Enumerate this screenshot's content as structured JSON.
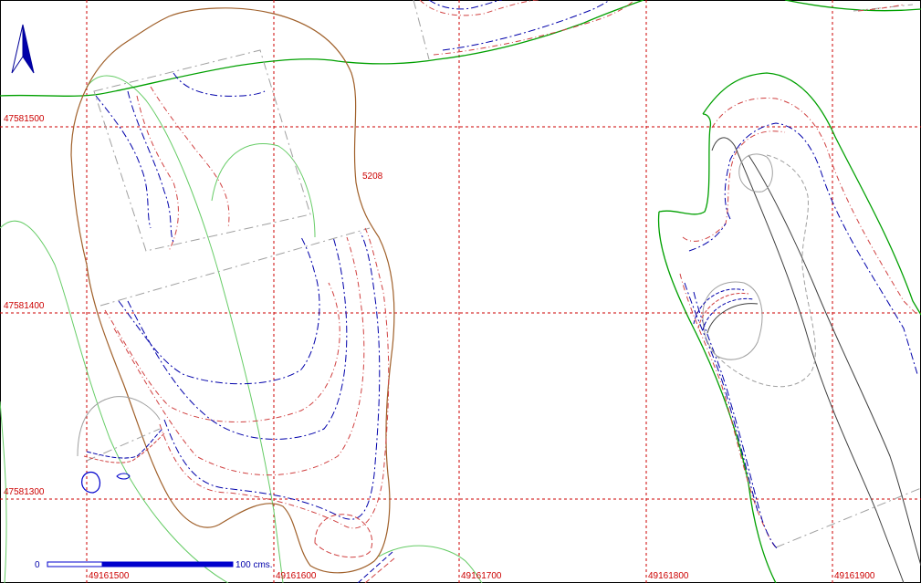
{
  "map": {
    "north_arrow": "north-arrow-icon",
    "grid": {
      "easting_labels": [
        "49161500",
        "49161600",
        "49161700",
        "49161800",
        "49161900"
      ],
      "northing_labels": [
        "47581500",
        "47581400",
        "47581300"
      ]
    },
    "contour_label": "5208",
    "scale_bar": {
      "start_label": "0",
      "end_label": "100 cms."
    },
    "colors": {
      "grid": "#cc0000",
      "contour_red": "#d04040",
      "contour_blue": "#0000aa",
      "boundary_green": "#00aa00",
      "light_green": "#66cc66",
      "brown": "#a0602a",
      "gray": "#a0a0a0",
      "dark": "#404040",
      "scale_blue": "#0000cc"
    }
  }
}
